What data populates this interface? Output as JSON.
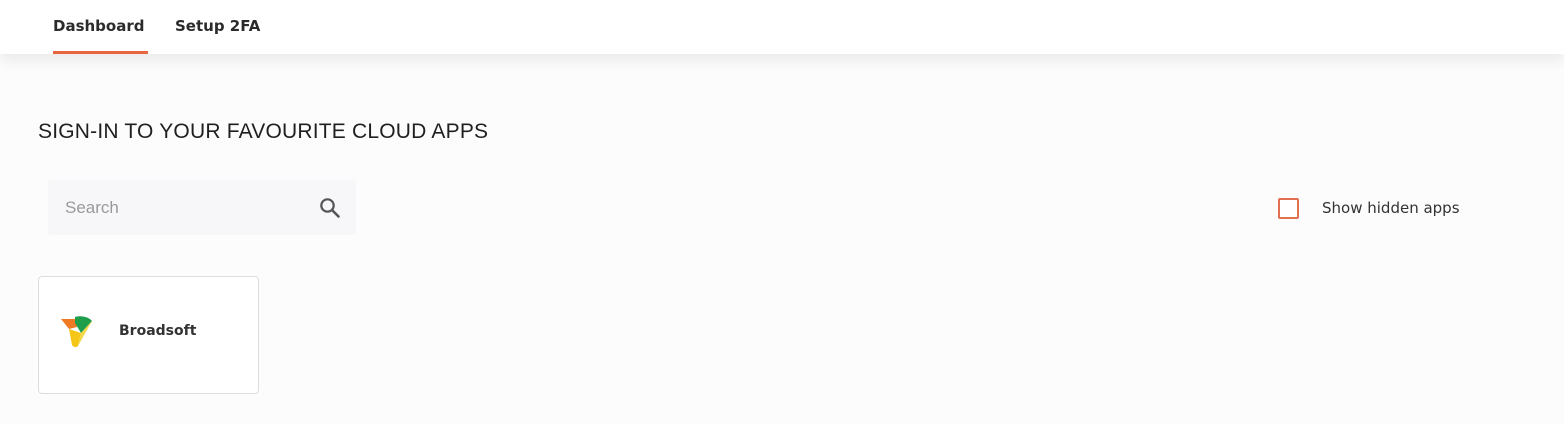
{
  "nav": {
    "tabs": [
      {
        "label": "Dashboard",
        "active": true
      },
      {
        "label": "Setup 2FA",
        "active": false
      }
    ],
    "accent_color": "#e8663f"
  },
  "main": {
    "title": "SIGN-IN TO YOUR FAVOURITE CLOUD APPS",
    "search": {
      "placeholder": "Search",
      "value": "",
      "icon": "search-icon"
    },
    "show_hidden": {
      "label": "Show hidden apps",
      "checked": false
    },
    "apps": [
      {
        "name": "Broadsoft",
        "icon": "broadsoft-logo-icon"
      }
    ]
  }
}
